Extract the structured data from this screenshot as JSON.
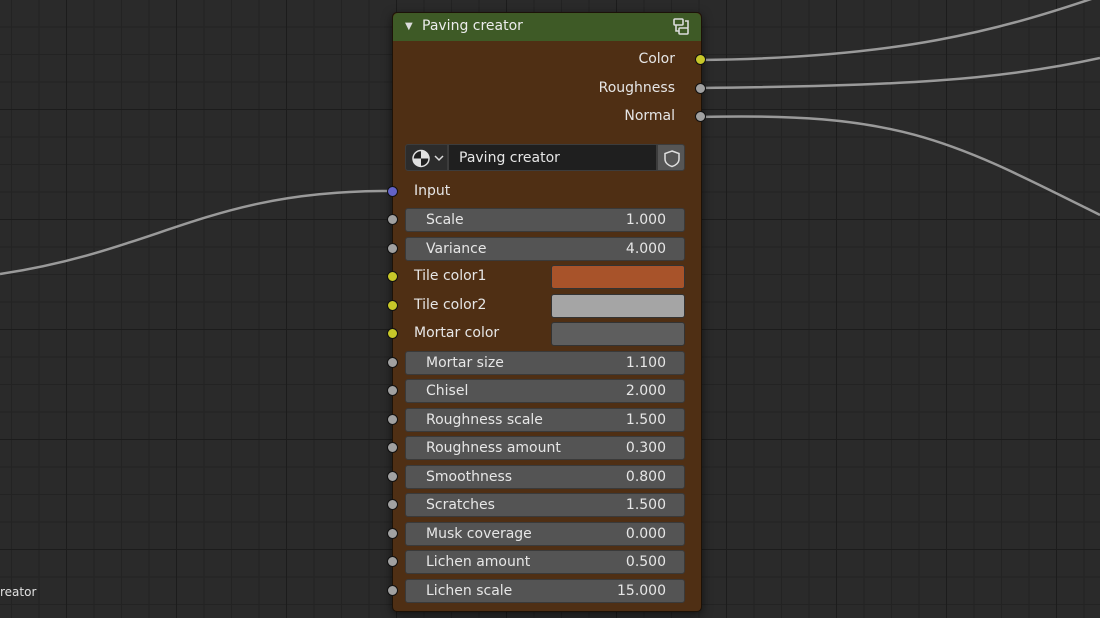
{
  "frame_label": "reator",
  "node": {
    "title": "Paving creator",
    "header_color": "#3e5a26",
    "body_color": "#4f2f14",
    "outputs": [
      {
        "label": "Color",
        "socket": "yellow"
      },
      {
        "label": "Roughness",
        "socket": "grey"
      },
      {
        "label": "Normal",
        "socket": "grey"
      }
    ],
    "group_selector": {
      "type_icon": "node-tree-icon",
      "name": "Paving creator",
      "fake_user_icon": "shield-icon"
    },
    "input_label": "Input",
    "inputs": [
      {
        "label": "Scale",
        "value": "1.000",
        "kind": "number"
      },
      {
        "label": "Variance",
        "value": "4.000",
        "kind": "number"
      },
      {
        "label": "Tile color1",
        "kind": "color",
        "color": "#a8532a"
      },
      {
        "label": "Tile color2",
        "kind": "color",
        "color": "#a5a5a5"
      },
      {
        "label": "Mortar color",
        "kind": "color",
        "color": "#5e5e5e"
      },
      {
        "label": "Mortar size",
        "value": "1.100",
        "kind": "number"
      },
      {
        "label": "Chisel",
        "value": "2.000",
        "kind": "number"
      },
      {
        "label": "Roughness scale",
        "value": "1.500",
        "kind": "number"
      },
      {
        "label": "Roughness amount",
        "value": "0.300",
        "kind": "number"
      },
      {
        "label": "Smoothness",
        "value": "0.800",
        "kind": "number"
      },
      {
        "label": "Scratches",
        "value": "1.500",
        "kind": "number"
      },
      {
        "label": "Musk coverage",
        "value": "0.000",
        "kind": "number"
      },
      {
        "label": "Lichen amount",
        "value": "0.500",
        "kind": "number"
      },
      {
        "label": "Lichen scale",
        "value": "15.000",
        "kind": "number"
      }
    ]
  }
}
